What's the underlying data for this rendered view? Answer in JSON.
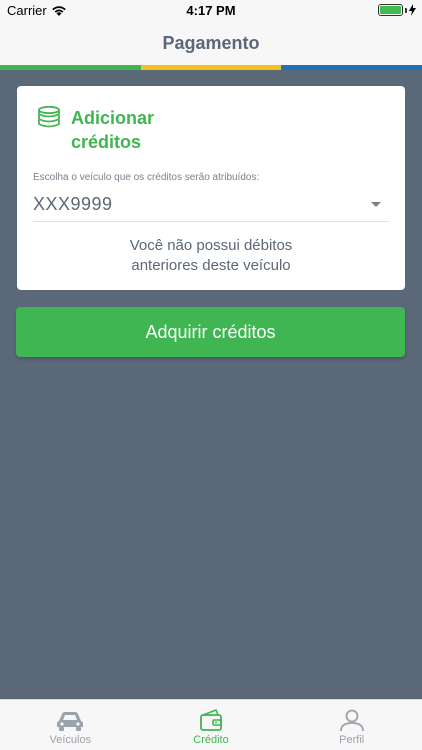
{
  "status_bar": {
    "carrier": "Carrier",
    "time": "4:17 PM"
  },
  "nav": {
    "title": "Pagamento"
  },
  "card": {
    "title": "Adicionar créditos",
    "field_label": "Escolha o veículo que os créditos serão atribuídos:",
    "selected_vehicle": "XXX9999",
    "info_line1": "Você não possui débitos",
    "info_line2": "anteriores deste veículo"
  },
  "actions": {
    "buy_label": "Adquirir créditos"
  },
  "tabs": [
    {
      "label": "Veículos",
      "icon": "car-icon",
      "active": false
    },
    {
      "label": "Crédito",
      "icon": "wallet-icon",
      "active": true
    },
    {
      "label": "Perfil",
      "icon": "user-icon",
      "active": false
    }
  ],
  "colors": {
    "accent": "#3fb651",
    "yellow": "#f3c21b",
    "blue": "#1f72b8",
    "background": "#5a6878"
  }
}
